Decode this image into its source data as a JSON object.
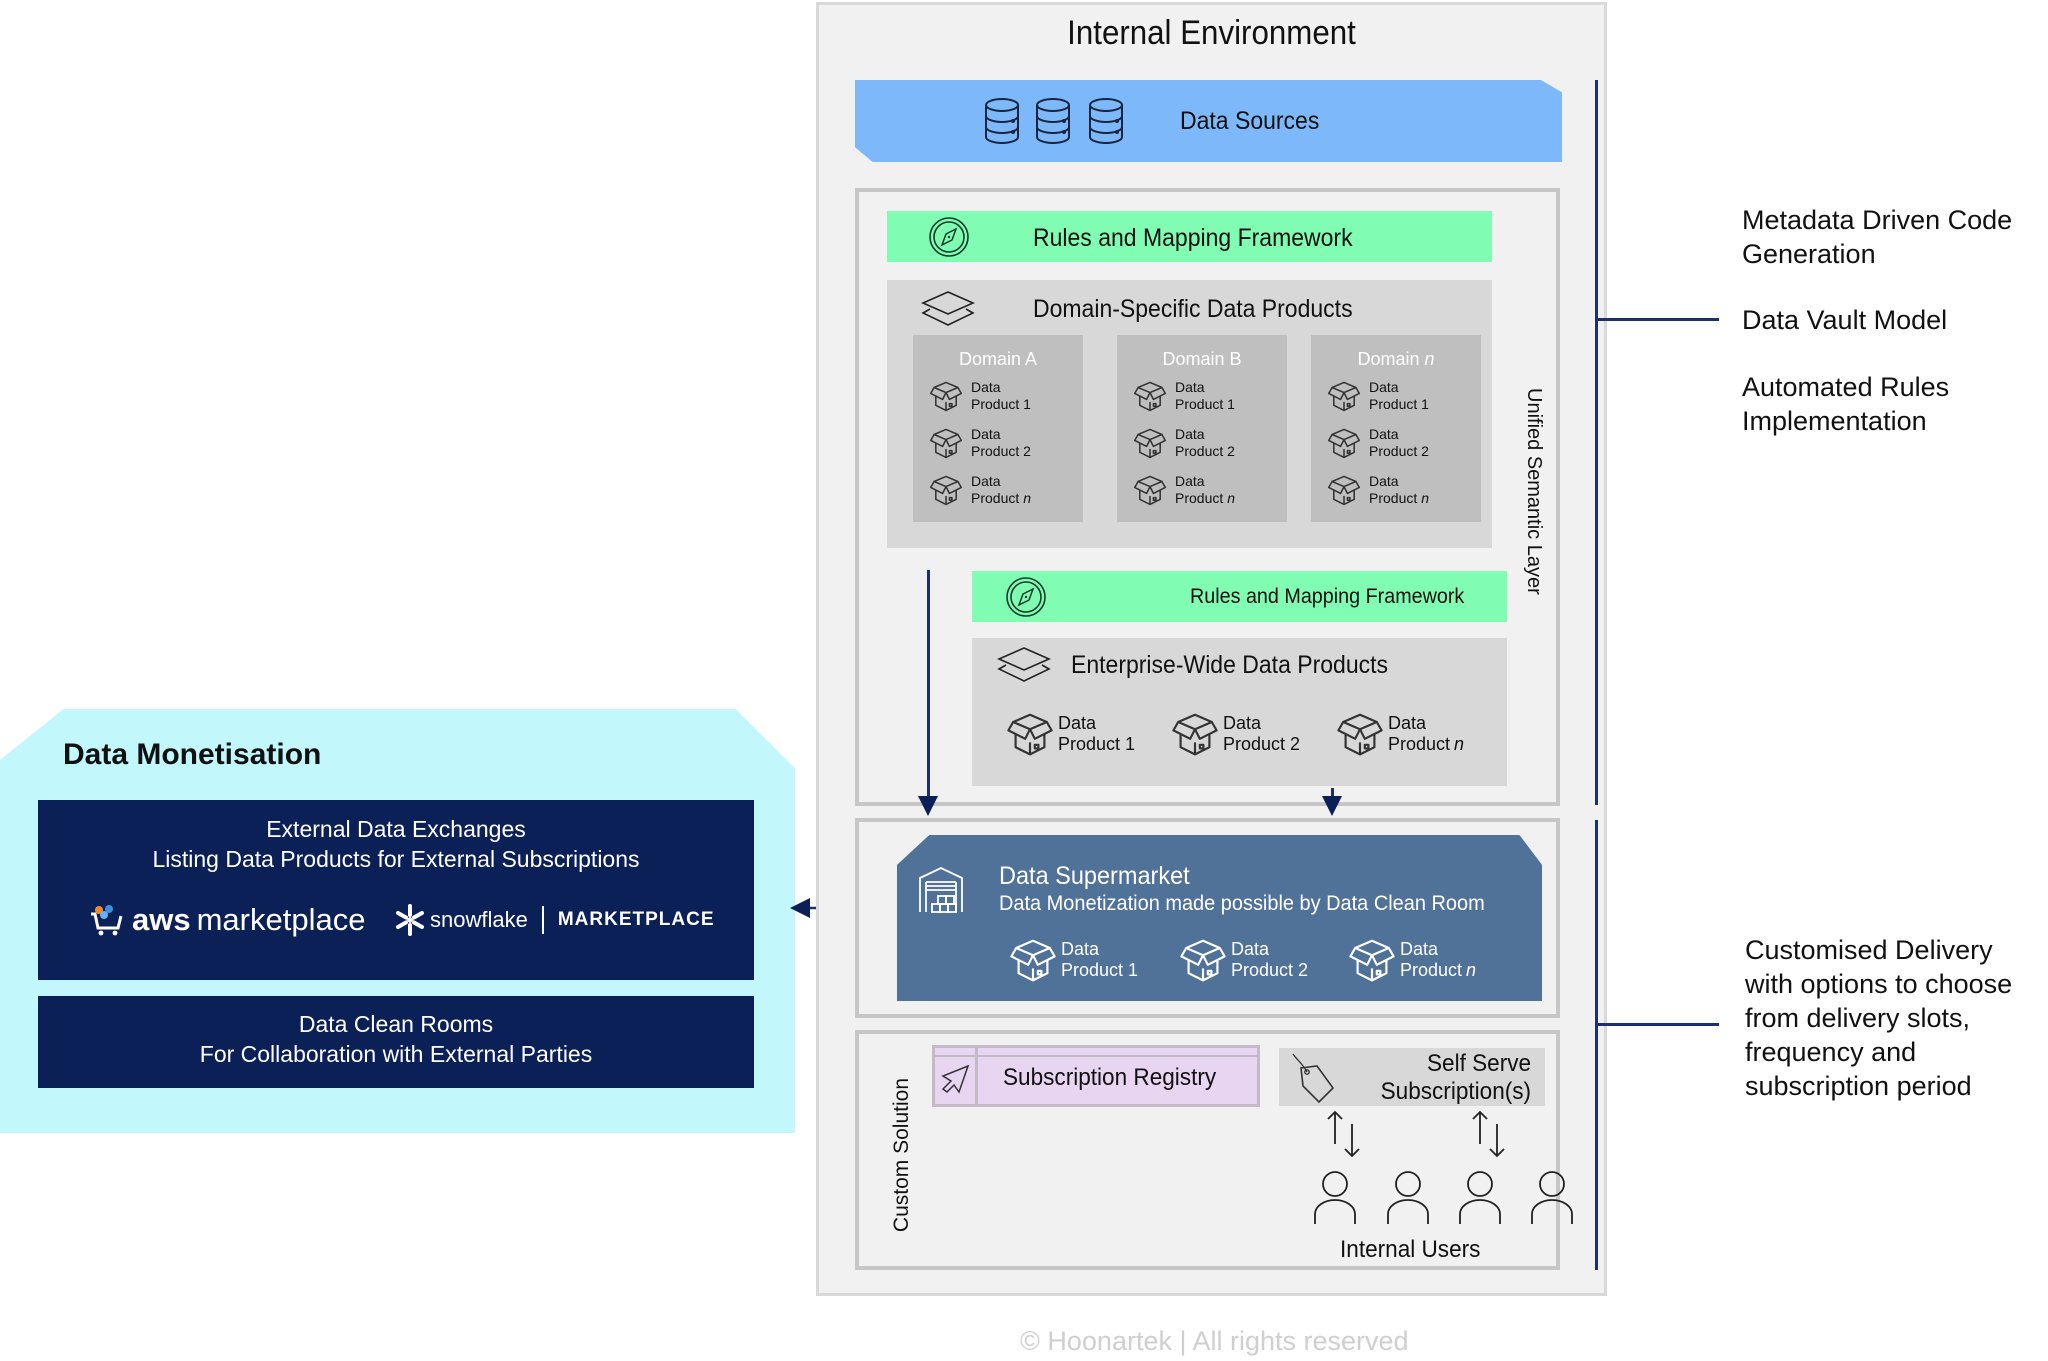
{
  "internal_environment": {
    "title": "Internal Environment",
    "data_sources": {
      "label": "Data Sources",
      "icon": "database-icon",
      "icon_count": 3
    },
    "rules_framework_top": {
      "label": "Rules and Mapping Framework",
      "icon": "compass-icon"
    },
    "domain_specific": {
      "title": "Domain-Specific Data Products",
      "icon": "layers-icon",
      "domains": [
        {
          "name": "Domain A",
          "products": [
            {
              "line1": "Data",
              "line2": "Product 1"
            },
            {
              "line1": "Data",
              "line2": "Product 2"
            },
            {
              "line1": "Data",
              "line2": "Product",
              "suffix": "n"
            }
          ]
        },
        {
          "name": "Domain B",
          "products": [
            {
              "line1": "Data",
              "line2": "Product 1"
            },
            {
              "line1": "Data",
              "line2": "Product 2"
            },
            {
              "line1": "Data",
              "line2": "Product",
              "suffix": "n"
            }
          ]
        },
        {
          "name": "Domain",
          "name_suffix": "n",
          "products": [
            {
              "line1": "Data",
              "line2": "Product 1"
            },
            {
              "line1": "Data",
              "line2": "Product 2"
            },
            {
              "line1": "Data",
              "line2": "Product",
              "suffix": "n"
            }
          ]
        }
      ]
    },
    "rules_framework_bottom": {
      "label": "Rules and Mapping Framework",
      "icon": "compass-icon"
    },
    "enterprise_wide": {
      "title": "Enterprise-Wide Data Products",
      "icon": "layers-icon",
      "products": [
        {
          "line1": "Data",
          "line2": "Product 1"
        },
        {
          "line1": "Data",
          "line2": "Product 2"
        },
        {
          "line1": "Data",
          "line2": "Product",
          "suffix": "n"
        }
      ]
    },
    "unified_semantic_layer": "Unified Semantic Layer",
    "data_supermarket": {
      "title": "Data Supermarket",
      "subtitle": "Data Monetization made possible by Data Clean Room",
      "icon": "warehouse-icon",
      "products": [
        {
          "line1": "Data",
          "line2": "Product 1"
        },
        {
          "line1": "Data",
          "line2": "Product 2"
        },
        {
          "line1": "Data",
          "line2": "Product",
          "suffix": "n"
        }
      ]
    },
    "custom_solution": {
      "label": "Custom Solution",
      "subscription_registry": {
        "label": "Subscription Registry",
        "icon": "cursor-arrow-icon"
      },
      "self_serve": {
        "line1": "Self Serve",
        "line2": "Subscription(s)",
        "icon": "price-tag-icon"
      },
      "internal_users": {
        "label": "Internal Users",
        "count": 4
      }
    }
  },
  "data_monetisation": {
    "title": "Data Monetisation",
    "exchanges": {
      "line1": "External Data Exchanges",
      "line2": "Listing Data Products for External Subscriptions",
      "logos": {
        "aws": "aws marketplace",
        "snowflake": "snowflake",
        "snowflake_marketplace": "MARKETPLACE"
      }
    },
    "clean_rooms": {
      "line1": "Data Clean Rooms",
      "line2": "For Collaboration with External Parties"
    }
  },
  "right_notes": {
    "upper": [
      "Metadata Driven Code Generation",
      "Data Vault Model",
      "Automated Rules Implementation"
    ],
    "upper_lines": [
      [
        "Metadata Driven Code",
        "Generation"
      ],
      [
        "Data Vault Model"
      ],
      [
        "Automated Rules",
        "Implementation"
      ]
    ],
    "lower_lines": [
      "Customised Delivery",
      "with options to choose",
      "from delivery slots,",
      "frequency and",
      "subscription period"
    ]
  },
  "footer": "© Hoonartek | All rights reserved",
  "colors": {
    "data_sources": "#7db9fa",
    "rules_green": "#80fdb3",
    "supermarket": "#507298",
    "monetisation_bg": "#c2f7fc",
    "navy": "#0c2058",
    "connector": "#1c2f6e",
    "registry": "#e8d5f2"
  }
}
